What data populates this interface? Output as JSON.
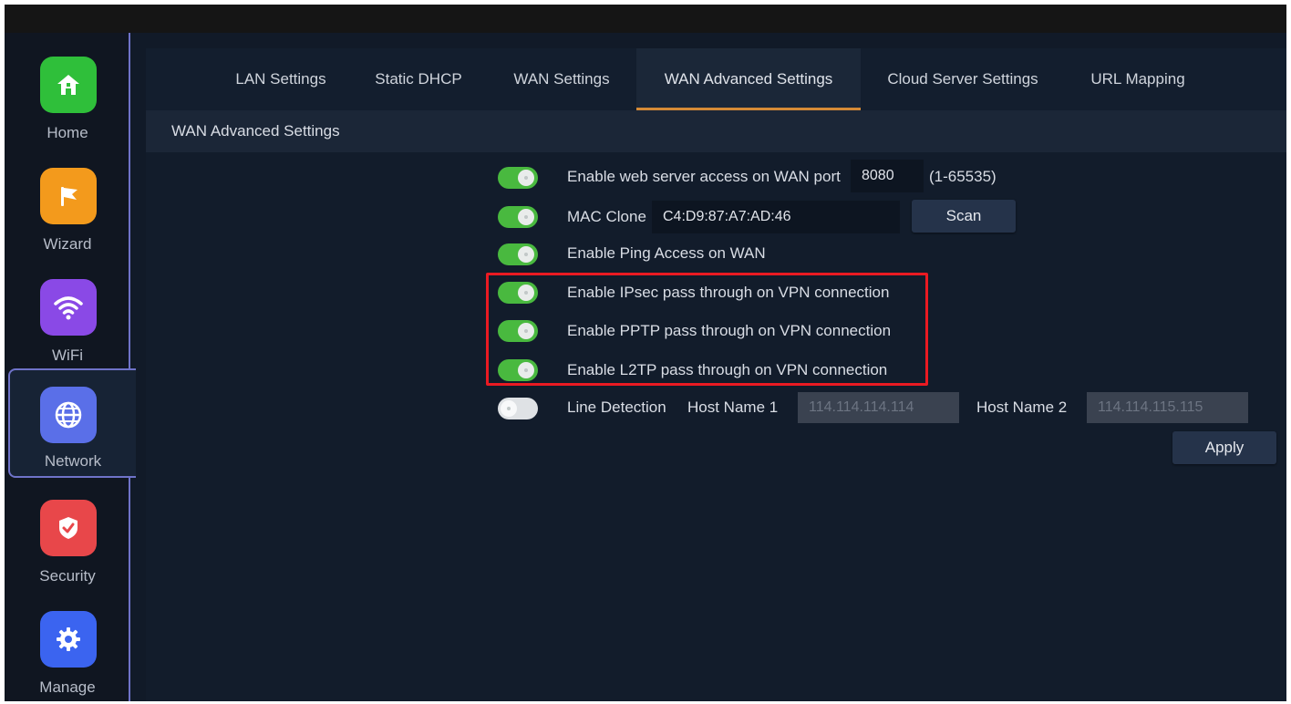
{
  "sidebar": {
    "items": [
      {
        "label": "Home",
        "icon": "home-icon",
        "color": "#2fbf3a"
      },
      {
        "label": "Wizard",
        "icon": "flag-icon",
        "color": "#f39a1c"
      },
      {
        "label": "WiFi",
        "icon": "wifi-icon",
        "color": "#8a49e6"
      },
      {
        "label": "Network",
        "icon": "globe-icon",
        "color": "#5a6fe8"
      },
      {
        "label": "Security",
        "icon": "shield-icon",
        "color": "#e8474a"
      },
      {
        "label": "Manage",
        "icon": "gear-icon",
        "color": "#3b64f0"
      }
    ],
    "active": "Network"
  },
  "tabs": [
    {
      "label": "LAN Settings"
    },
    {
      "label": "Static DHCP"
    },
    {
      "label": "WAN Settings"
    },
    {
      "label": "WAN Advanced Settings"
    },
    {
      "label": "Cloud Server Settings"
    },
    {
      "label": "URL Mapping"
    }
  ],
  "active_tab": "WAN Advanced Settings",
  "section": {
    "title": "WAN Advanced Settings"
  },
  "settings": {
    "web_access": {
      "label": "Enable web server access on WAN port",
      "enabled": true,
      "port": "8080",
      "range": "(1-65535)"
    },
    "mac_clone": {
      "label": "MAC Clone",
      "enabled": true,
      "value": "C4:D9:87:A7:AD:46",
      "scan_label": "Scan"
    },
    "ping": {
      "label": "Enable Ping Access on WAN",
      "enabled": true
    },
    "ipsec": {
      "label": "Enable IPsec pass through on VPN connection",
      "enabled": true
    },
    "pptp": {
      "label": "Enable PPTP pass through on VPN connection",
      "enabled": true
    },
    "l2tp": {
      "label": "Enable L2TP pass through on VPN connection",
      "enabled": true
    },
    "line_detection": {
      "label": "Line Detection",
      "enabled": false,
      "host1_label": "Host Name 1",
      "host1_value": "114.114.114.114",
      "host2_label": "Host Name 2",
      "host2_value": "114.114.115.115"
    }
  },
  "apply_label": "Apply",
  "colors": {
    "accent": "#d58a36",
    "toggle_on": "#49b93f",
    "highlight": "#ea1a22"
  }
}
